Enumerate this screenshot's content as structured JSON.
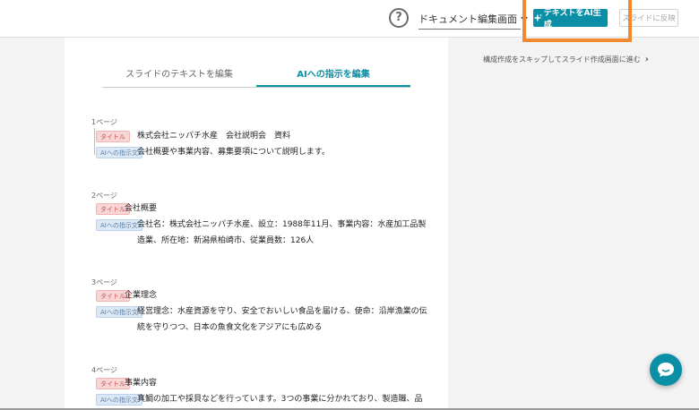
{
  "toolbar": {
    "help_icon": "?",
    "view_select_value": "ドキュメント編集画面",
    "generate_button_label": "テキストをAI生成",
    "apply_button_label": "スライドに反映"
  },
  "tabs": [
    {
      "label": "スライドのテキストを編集",
      "active": false
    },
    {
      "label": "AIへの指示を編集",
      "active": true
    }
  ],
  "skip_link": "構成作成をスキップしてスライド作成画面に進む",
  "pages": [
    {
      "label": "1ページ",
      "title_tag": "タイトル",
      "title": "株式会社ニッパチ水産　会社説明会　資料",
      "instr_tag": "AIへの指示文",
      "instruction_lines": [
        "会社概要や事業内容、募集要項について説明します。"
      ]
    },
    {
      "label": "2ページ",
      "title_tag": "タイトル",
      "title": "会社概要",
      "instr_tag": "AIへの指示文",
      "instruction_lines": [
        "会社名：株式会社ニッパチ水産、設立：1988年11月、事業内容：水産加工品製",
        "造業、所在地：新潟県柏崎市、従業員数：126人"
      ]
    },
    {
      "label": "3ページ",
      "title_tag": "タイトル",
      "title": "企業理念",
      "instr_tag": "AIへの指示文",
      "instruction_lines": [
        "経営理念：水産資源を守り、安全でおいしい食品を届ける、使命：沿岸漁業の伝",
        "統を守りつつ、日本の魚食文化をアジアにも広める"
      ]
    },
    {
      "label": "4ページ",
      "title_tag": "タイトル",
      "title": "事業内容",
      "instr_tag": "AIへの指示文",
      "instruction_lines": [
        "真鯛の加工や採貝などを行っています。3つの事業に分かれており、製造職、品"
      ]
    }
  ],
  "colors": {
    "accent": "#0b8fa6",
    "highlight": "#f0892f",
    "title_tag_bg": "#f9d6d6",
    "instr_tag_bg": "#dce8f5"
  },
  "icons": {
    "chat": "chat-bubble-icon",
    "sparkle": "sparkle-icon",
    "chevron": "chevron-right-icon"
  }
}
